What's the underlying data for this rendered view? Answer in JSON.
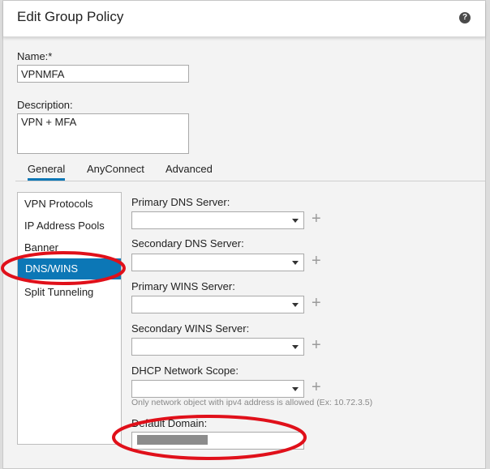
{
  "dialog": {
    "title": "Edit Group Policy",
    "help_icon": "?"
  },
  "form": {
    "name_label": "Name:*",
    "name_value": "VPNMFA",
    "description_label": "Description:",
    "description_value": "VPN + MFA"
  },
  "tabs": [
    {
      "label": "General",
      "active": true
    },
    {
      "label": "AnyConnect",
      "active": false
    },
    {
      "label": "Advanced",
      "active": false
    }
  ],
  "sidebar": {
    "items": [
      {
        "label": "VPN Protocols"
      },
      {
        "label": "IP Address Pools"
      },
      {
        "label": "Banner"
      },
      {
        "label": "DNS/WINS",
        "active": true
      },
      {
        "label": "Split Tunneling"
      }
    ]
  },
  "fields": {
    "primary_dns_label": "Primary DNS Server:",
    "secondary_dns_label": "Secondary DNS Server:",
    "primary_wins_label": "Primary WINS Server:",
    "secondary_wins_label": "Secondary WINS Server:",
    "dhcp_label": "DHCP Network Scope:",
    "dhcp_hint": "Only network object with ipv4 address is allowed (Ex: 10.72.3.5)",
    "default_domain_label": "Default Domain:"
  },
  "colors": {
    "accent": "#0c77b6",
    "annotation": "#e0101a"
  }
}
